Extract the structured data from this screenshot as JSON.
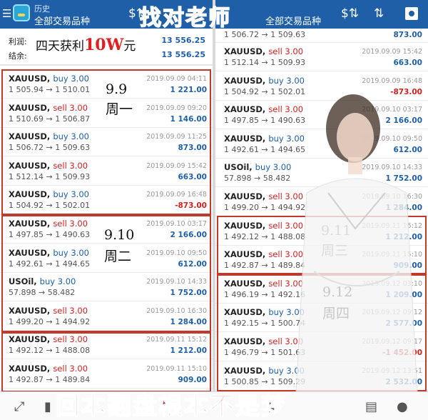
{
  "left": {
    "header": {
      "subtitle": "历史",
      "title": "全部交易品种"
    },
    "summary": {
      "profit_label": "利润:",
      "profit_value": "13 556.25",
      "balance_label": "结余:",
      "balance_value": "13 556.25"
    },
    "overlay_profit": {
      "prefix": "四天获利",
      "amount": "10W",
      "suffix": "元"
    },
    "trades": [
      {
        "symbol": "XAUUSD,",
        "type": "buy 3.00",
        "side": "buy",
        "date": "2019.09.09 04:11",
        "prices": "1 505.94 → 1 510.01",
        "profit": "1 221.00",
        "sign": "pos"
      },
      {
        "symbol": "XAUUSD,",
        "type": "sell 3.00",
        "side": "sell",
        "date": "2019.09.09 09:20",
        "prices": "1 510.69 → 1 506.87",
        "profit": "1 146.00",
        "sign": "pos"
      },
      {
        "symbol": "XAUUSD,",
        "type": "buy 3.00",
        "side": "buy",
        "date": "2019.09.09 11:25",
        "prices": "1 506.72 → 1 509.63",
        "profit": "873.00",
        "sign": "pos"
      },
      {
        "symbol": "XAUUSD,",
        "type": "sell 3.00",
        "side": "sell",
        "date": "2019.09.09 15:42",
        "prices": "1 512.14 → 1 509.93",
        "profit": "663.00",
        "sign": "pos"
      },
      {
        "symbol": "XAUUSD,",
        "type": "buy 3.00",
        "side": "buy",
        "date": "2019.09.09 16:48",
        "prices": "1 504.92 → 1 502.01",
        "profit": "-873.00",
        "sign": "neg"
      },
      {
        "symbol": "XAUUSD,",
        "type": "sell 3.00",
        "side": "sell",
        "date": "2019.09.10 03:17",
        "prices": "1 497.85 → 1 490.63",
        "profit": "2 166.00",
        "sign": "pos"
      },
      {
        "symbol": "XAUUSD,",
        "type": "buy 3.00",
        "side": "buy",
        "date": "2019.09.10 09:50",
        "prices": "1 492.61 → 1 494.65",
        "profit": "612.00",
        "sign": "pos"
      },
      {
        "symbol": "USOil,",
        "type": "buy 3.00",
        "side": "buy",
        "date": "2019.09.10 14:33",
        "prices": "57.898 → 58.482",
        "profit": "1 752.00",
        "sign": "pos"
      },
      {
        "symbol": "XAUUSD,",
        "type": "sell 3.00",
        "side": "sell",
        "date": "2019.09.10 16:30",
        "prices": "1 499.20 → 1 494.92",
        "profit": "1 284.00",
        "sign": "pos"
      },
      {
        "symbol": "XAUUSD,",
        "type": "sell 3.00",
        "side": "sell",
        "date": "2019.09.11 15:12",
        "prices": "1 492.12 → 1 488.08",
        "profit": "1 212.00",
        "sign": "pos"
      },
      {
        "symbol": "XAUUSD,",
        "type": "sell 3.00",
        "side": "sell",
        "date": "2019.09.11 15:10",
        "prices": "1 492.87 → 1 489.84",
        "profit": "909.00",
        "sign": "pos"
      }
    ],
    "day_labels": [
      {
        "date": "9.9",
        "weekday": "周一"
      },
      {
        "date": "9.10",
        "weekday": "周二"
      }
    ]
  },
  "right": {
    "header": {
      "title": "全部交易品种"
    },
    "partial_row": {
      "prices": "1 506.72 → 1 509.63",
      "profit": "873.00"
    },
    "trades": [
      {
        "symbol": "XAUUSD,",
        "type": "sell 3.00",
        "side": "sell",
        "date": "2019.09.09 15:42",
        "prices": "1 512.14 → 1 509.93",
        "profit": "663.00",
        "sign": "pos"
      },
      {
        "symbol": "XAUUSD,",
        "type": "buy 3.00",
        "side": "buy",
        "date": "2019.09.09 16:48",
        "prices": "1 504.92 → 1 502.01",
        "profit": "-873.00",
        "sign": "neg"
      },
      {
        "symbol": "XAUUSD,",
        "type": "sell 3.00",
        "side": "sell",
        "date": "2019.09.10 03:17",
        "prices": "1 497.85 → 1 490.63",
        "profit": "2 166.00",
        "sign": "pos"
      },
      {
        "symbol": "XAUUSD,",
        "type": "buy 3.00",
        "side": "buy",
        "date": "2019.09.10 09:50",
        "prices": "1 492.61 → 1 494.65",
        "profit": "612.00",
        "sign": "pos"
      },
      {
        "symbol": "USOil,",
        "type": "buy 3.00",
        "side": "buy",
        "date": "2019.09.10 14:33",
        "prices": "57.898 → 58.482",
        "profit": "1 752.00",
        "sign": "pos"
      },
      {
        "symbol": "XAUUSD,",
        "type": "sell 3.00",
        "side": "sell",
        "date": "2019.09.10 16:30",
        "prices": "1 499.20 → 1 494.92",
        "profit": "1 284.00",
        "sign": "pos"
      },
      {
        "symbol": "XAUUSD,",
        "type": "sell 3.00",
        "side": "sell",
        "date": "2019.09.11 15:12",
        "prices": "1 492.12 → 1 488.08",
        "profit": "1 212.00",
        "sign": "pos"
      },
      {
        "symbol": "XAUUSD,",
        "type": "sell 3.00",
        "side": "sell",
        "date": "2019.09.11 15:10",
        "prices": "1 492.87 → 1 489.84",
        "profit": "909.00",
        "sign": "pos"
      },
      {
        "symbol": "XAUUSD,",
        "type": "sell 3.00",
        "side": "sell",
        "date": "2019.09.12 03:10",
        "prices": "1 496.19 → 1 492.16",
        "profit": "1 209.00",
        "sign": "pos"
      },
      {
        "symbol": "XAUUSD,",
        "type": "buy 3.00",
        "side": "buy",
        "date": "2019.09.12 09:12",
        "prices": "1 492.15 → 1 500.74",
        "profit": "2 577.00",
        "sign": "pos"
      },
      {
        "symbol": "XAUUSD,",
        "type": "sell 3.00",
        "side": "sell",
        "date": "2019.09.12 09:17",
        "prices": "1 496.79 → 1 501.63",
        "profit": "-1 452.00",
        "sign": "neg"
      },
      {
        "symbol": "XAUUSD,",
        "type": "buy 3.00",
        "side": "buy",
        "date": "2019.09.12 13:51",
        "prices": "1 500.85 → 1 509.29",
        "profit": "2 532.00",
        "sign": "pos"
      }
    ],
    "day_labels": [
      {
        "date": "9.11",
        "weekday": "周三"
      },
      {
        "date": "9.12",
        "weekday": "周四"
      }
    ]
  },
  "overlays": {
    "top_text": "找对老师",
    "bottom_text": "回本翻盘根本不是梦"
  },
  "icons": {
    "menu": "menu-icon",
    "dollar_swap": "dollar-swap-icon",
    "sort": "sort-icon",
    "calendar": "calendar-icon"
  },
  "colors": {
    "header_bg": "#1f5fa8",
    "buy": "#1f5fa8",
    "sell": "#d42020",
    "overlay_red": "#e8141e",
    "group_border": "#c0392b"
  }
}
